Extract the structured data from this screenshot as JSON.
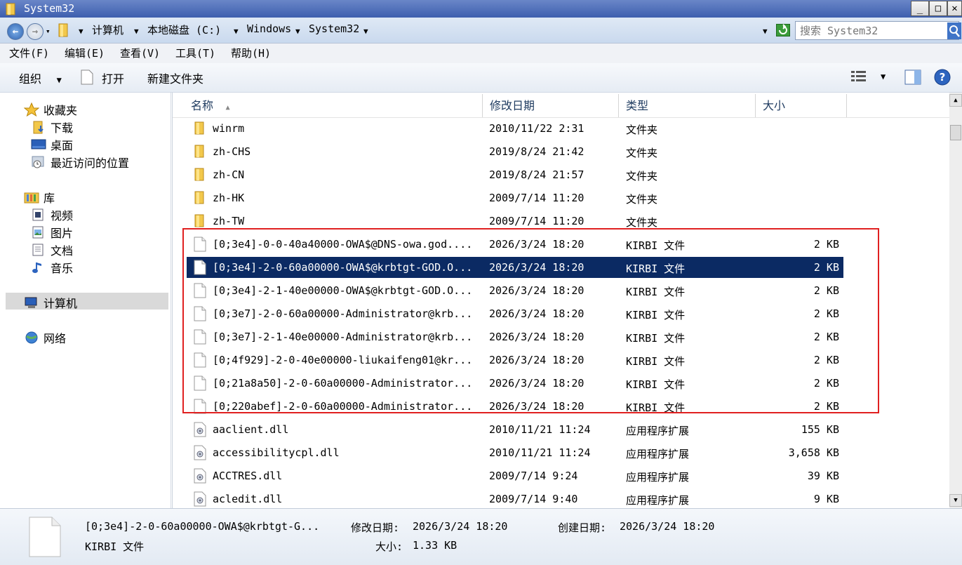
{
  "window": {
    "title": "System32"
  },
  "address": {
    "crumbs": [
      "计算机",
      "本地磁盘 (C:)",
      "Windows",
      "System32"
    ],
    "search_placeholder": "搜索 System32"
  },
  "menu": [
    "文件(F)",
    "编辑(E)",
    "查看(V)",
    "工具(T)",
    "帮助(H)"
  ],
  "toolbar": {
    "organize": "组织",
    "open": "打开",
    "new_folder": "新建文件夹"
  },
  "nav": {
    "favorites": "收藏夹",
    "downloads": "下载",
    "desktop": "桌面",
    "recent": "最近访问的位置",
    "libraries": "库",
    "videos": "视频",
    "pictures": "图片",
    "documents": "文档",
    "music": "音乐",
    "computer": "计算机",
    "network": "网络"
  },
  "columns": {
    "name": "名称",
    "date": "修改日期",
    "type": "类型",
    "size": "大小"
  },
  "files": [
    {
      "name": "winrm",
      "date": "2010/11/22 2:31",
      "type": "文件夹",
      "size": "",
      "icon": "folder-icon"
    },
    {
      "name": "zh-CHS",
      "date": "2019/8/24 21:42",
      "type": "文件夹",
      "size": "",
      "icon": "folder-icon"
    },
    {
      "name": "zh-CN",
      "date": "2019/8/24 21:57",
      "type": "文件夹",
      "size": "",
      "icon": "folder-icon"
    },
    {
      "name": "zh-HK",
      "date": "2009/7/14 11:20",
      "type": "文件夹",
      "size": "",
      "icon": "folder-icon"
    },
    {
      "name": "zh-TW",
      "date": "2009/7/14 11:20",
      "type": "文件夹",
      "size": "",
      "icon": "folder-icon"
    },
    {
      "name": "[0;3e4]-0-0-40a40000-OWA$@DNS-owa.god....",
      "date": "2026/3/24 18:20",
      "type": "KIRBI 文件",
      "size": "2 KB",
      "icon": "file-icon"
    },
    {
      "name": "[0;3e4]-2-0-60a00000-OWA$@krbtgt-GOD.O...",
      "date": "2026/3/24 18:20",
      "type": "KIRBI 文件",
      "size": "2 KB",
      "icon": "file-icon",
      "selected": true
    },
    {
      "name": "[0;3e4]-2-1-40e00000-OWA$@krbtgt-GOD.O...",
      "date": "2026/3/24 18:20",
      "type": "KIRBI 文件",
      "size": "2 KB",
      "icon": "file-icon"
    },
    {
      "name": "[0;3e7]-2-0-60a00000-Administrator@krb...",
      "date": "2026/3/24 18:20",
      "type": "KIRBI 文件",
      "size": "2 KB",
      "icon": "file-icon"
    },
    {
      "name": "[0;3e7]-2-1-40e00000-Administrator@krb...",
      "date": "2026/3/24 18:20",
      "type": "KIRBI 文件",
      "size": "2 KB",
      "icon": "file-icon"
    },
    {
      "name": "[0;4f929]-2-0-40e00000-liukaifeng01@kr...",
      "date": "2026/3/24 18:20",
      "type": "KIRBI 文件",
      "size": "2 KB",
      "icon": "file-icon"
    },
    {
      "name": "[0;21a8a50]-2-0-60a00000-Administrator...",
      "date": "2026/3/24 18:20",
      "type": "KIRBI 文件",
      "size": "2 KB",
      "icon": "file-icon"
    },
    {
      "name": "[0;220abef]-2-0-60a00000-Administrator...",
      "date": "2026/3/24 18:20",
      "type": "KIRBI 文件",
      "size": "2 KB",
      "icon": "file-icon"
    },
    {
      "name": "aaclient.dll",
      "date": "2010/11/21 11:24",
      "type": "应用程序扩展",
      "size": "155 KB",
      "icon": "dll-icon"
    },
    {
      "name": "accessibilitycpl.dll",
      "date": "2010/11/21 11:24",
      "type": "应用程序扩展",
      "size": "3,658 KB",
      "icon": "dll-icon"
    },
    {
      "name": "ACCTRES.dll",
      "date": "2009/7/14 9:24",
      "type": "应用程序扩展",
      "size": "39 KB",
      "icon": "dll-icon"
    },
    {
      "name": "acledit.dll",
      "date": "2009/7/14 9:40",
      "type": "应用程序扩展",
      "size": "9 KB",
      "icon": "dll-icon"
    }
  ],
  "details": {
    "name": "[0;3e4]-2-0-60a00000-OWA$@krbtgt-G...",
    "type": "KIRBI 文件",
    "modified_label": "修改日期:",
    "modified": "2026/3/24 18:20",
    "created_label": "创建日期:",
    "created": "2026/3/24 18:20",
    "size_label": "大小:",
    "size": "1.33 KB"
  },
  "colors": {
    "selection": "#0b2a63",
    "highlight_box": "#e02020"
  }
}
